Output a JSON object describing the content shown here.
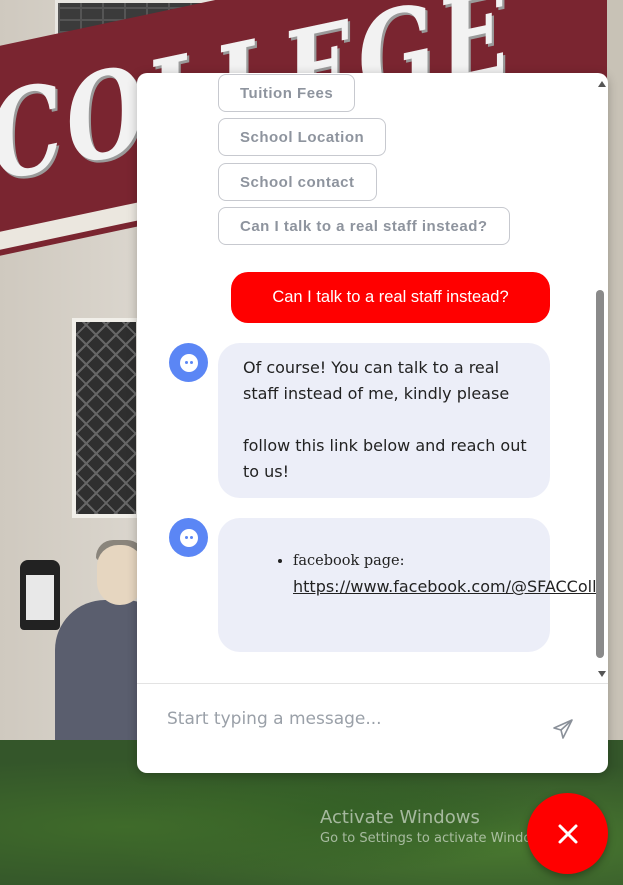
{
  "background": {
    "sign_letters": "COLLEGE"
  },
  "chat": {
    "quick_replies": [
      "Tuition Fees",
      "School Location",
      "School contact",
      "Can I talk to a real staff instead?"
    ],
    "user_message": "Can I talk to a real staff instead?",
    "bot_message_1": {
      "line1": "Of course! You can talk to a real staff instead of me, kindly please",
      "line2": "follow this link below and reach out to us!"
    },
    "bot_message_2": {
      "list_label": "facebook page:",
      "link_text": "https://www.facebook.com/@SFACCollegeLasPinas"
    },
    "composer": {
      "placeholder": "Start typing a message..."
    },
    "icons": {
      "bot_avatar": "robot-face-icon",
      "send": "paper-plane-icon",
      "close": "close-icon"
    }
  },
  "colors": {
    "accent": "#ff0000",
    "bot_avatar": "#5b86f5",
    "bot_bubble": "#eceef8"
  },
  "watermark": {
    "title": "Activate Windows",
    "subtitle": "Go to Settings to activate Windows."
  }
}
